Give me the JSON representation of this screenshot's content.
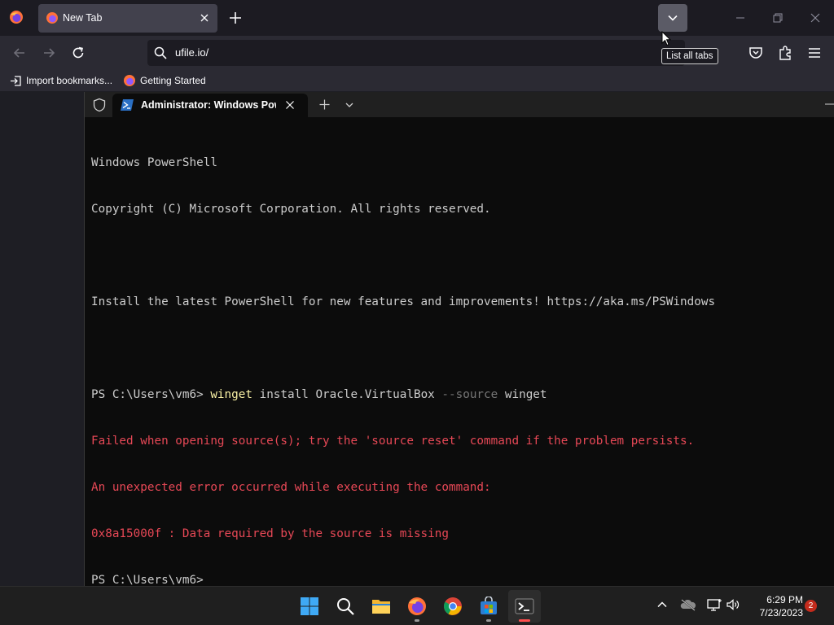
{
  "browser": {
    "tab_title": "New Tab",
    "tooltip": "List all tabs",
    "url": "ufile.io/",
    "bookmarks": [
      {
        "label": "Import bookmarks...",
        "icon": "import-icon"
      },
      {
        "label": "Getting Started",
        "icon": "firefox-icon"
      }
    ]
  },
  "terminal": {
    "tab_title": "Administrator: Windows PowerShell",
    "lines": {
      "l1": "Windows PowerShell",
      "l2": "Copyright (C) Microsoft Corporation. All rights reserved.",
      "l3": "Install the latest PowerShell for new features and improvements! https://aka.ms/PSWindows",
      "prompt": "PS C:\\Users\\vm6> ",
      "cmd_name": "winget",
      "cmd_args1": " install Oracle.VirtualBox ",
      "cmd_param": "--source",
      "cmd_args2": " winget",
      "err1": "Failed when opening source(s); try the 'source reset' command if the problem persists.",
      "err2": "An unexpected error occurred while executing the command:",
      "err3": "0x8a15000f : Data required by the source is missing",
      "prompt2": "PS C:\\Users\\vm6>"
    },
    "colors": {
      "command": "#f9f1a5",
      "parameter": "#767676",
      "error": "#e74856",
      "text": "#cccccc"
    }
  },
  "taskbar": {
    "apps": [
      "start-icon",
      "search-icon",
      "file-explorer-icon",
      "firefox-icon",
      "chrome-icon",
      "microsoft-store-icon",
      "terminal-icon"
    ],
    "time": "6:29 PM",
    "date": "7/23/2023",
    "notifications": "2"
  }
}
